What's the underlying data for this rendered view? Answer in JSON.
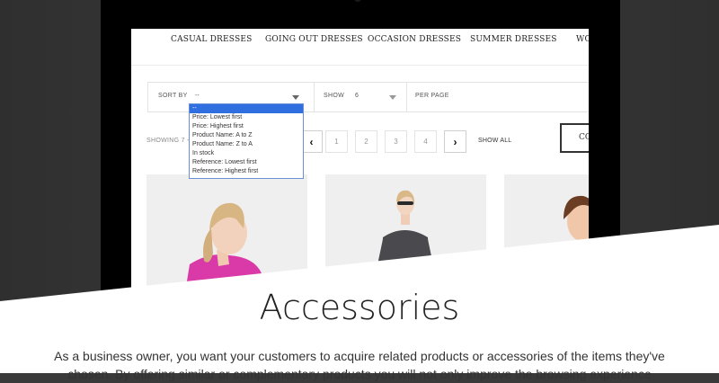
{
  "nav": {
    "items": [
      "CASUAL DRESSES",
      "GOING OUT DRESSES",
      "OCCASION DRESSES",
      "SUMMER DRESSES",
      "WO"
    ]
  },
  "toolbar": {
    "sort_label": "SORT BY",
    "sort_value": "--",
    "show_label": "SHOW",
    "show_value": "6",
    "per_page_label": "PER PAGE"
  },
  "sort_options": [
    "--",
    "Price: Lowest first",
    "Price: Highest first",
    "Product Name: A to Z",
    "Product Name: Z to A",
    "In stock",
    "Reference: Lowest first",
    "Reference: Highest first"
  ],
  "pagination": {
    "showing": "SHOWING 7 -",
    "pages": [
      "1",
      "2",
      "3",
      "4"
    ],
    "prev": "‹",
    "next": "›",
    "show_all": "SHOW ALL"
  },
  "compare_label": "CO",
  "section": {
    "title": "Accessories",
    "text": "As a business owner, you want your customers to acquire related products or accessories of the items they've chosen. By offering similar or complementary products you will not only improve the browsing experience"
  },
  "colors": {
    "accent_blue": "#2f6fe0",
    "product_bg": "#efefef",
    "magenta_top": "#d93aa8"
  }
}
